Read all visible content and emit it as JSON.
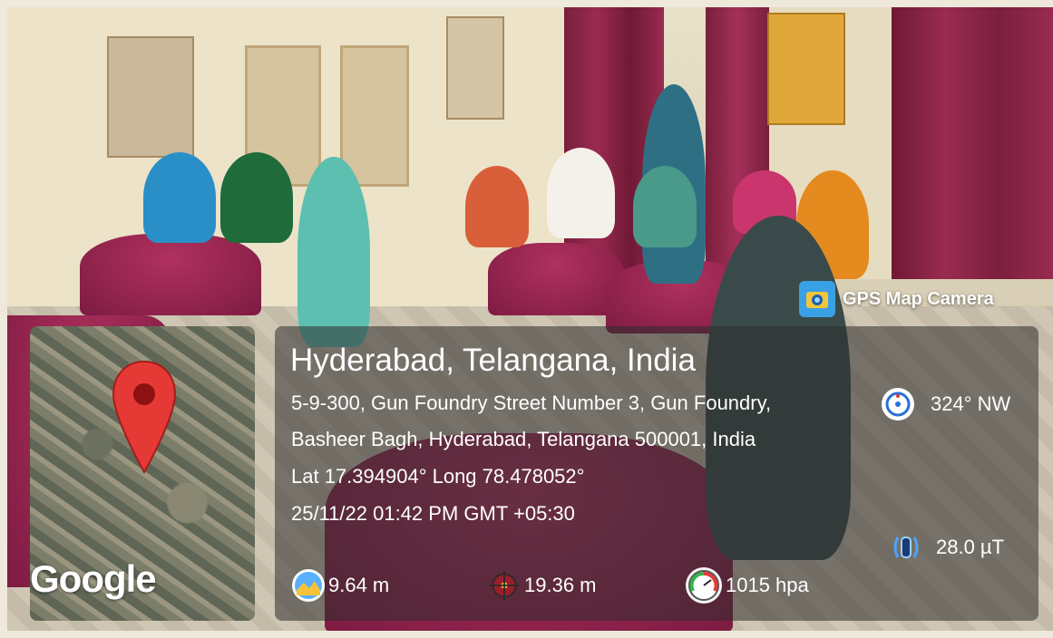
{
  "overlay": {
    "app_name": "GPS Map Camera",
    "map_attribution": "Google",
    "location_title": "Hyderabad, Telangana, India",
    "address_line1": "5-9-300, Gun Foundry Street Number 3, Gun Foundry,",
    "address_line2": "Basheer Bagh, Hyderabad, Telangana 500001, India",
    "coordinates": "Lat 17.394904° Long 78.478052°",
    "datetime": "25/11/22 01:42 PM GMT +05:30",
    "compass": "324° NW",
    "magnetic_field": "28.0 µT",
    "altitude": "9.64 m",
    "accuracy": "19.36 m",
    "pressure": "1015 hpa"
  },
  "icons": {
    "app": "gps-map-camera-icon",
    "pin": "map-pin-icon",
    "compass": "compass-icon",
    "magnet": "magnetic-field-icon",
    "altitude": "altitude-icon",
    "accuracy": "crosshair-icon",
    "pressure": "gauge-icon"
  },
  "colors": {
    "pin": "#e53935",
    "panel": "#2d2d2d",
    "text": "#ffffff"
  }
}
